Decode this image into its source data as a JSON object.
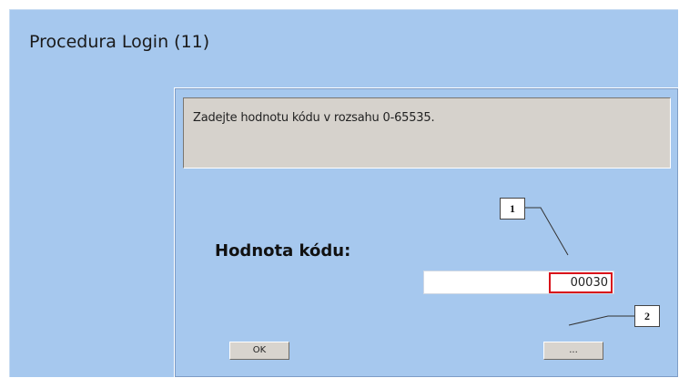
{
  "window": {
    "title": "Procedura Login (11)"
  },
  "dialog": {
    "message": "Zadejte hodnotu kódu v rozsahu 0-65535.",
    "field_label": "Hodnota kódu:",
    "code_value": "00030",
    "ok_label": "OK",
    "cancel_label": "..."
  },
  "callouts": {
    "one": "1",
    "two": "2"
  },
  "colors": {
    "window_bg": "#a6c8ee",
    "message_bg": "#d6d2cc",
    "highlight": "#d8101a"
  }
}
